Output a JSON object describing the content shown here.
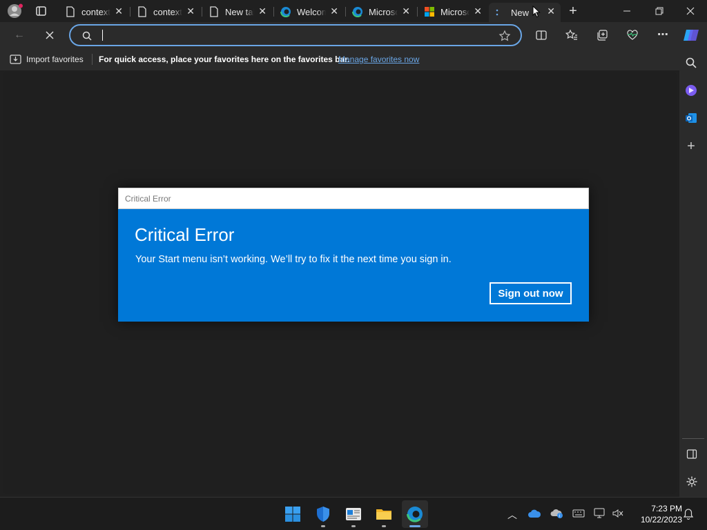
{
  "tabs": [
    {
      "title": "context",
      "favicon": "page-icon"
    },
    {
      "title": "context",
      "favicon": "page-icon"
    },
    {
      "title": "New tab",
      "favicon": "page-icon"
    },
    {
      "title": "Welcome",
      "favicon": "edge-icon"
    },
    {
      "title": "Microsoft",
      "favicon": "edge-icon"
    },
    {
      "title": "Microsoft",
      "favicon": "microsoft-logo-icon"
    },
    {
      "title": "New",
      "favicon": "loading-icon"
    }
  ],
  "address_bar": {
    "value": "",
    "placeholder": ""
  },
  "favorites_bar": {
    "import_label": "Import favorites",
    "hint": "For quick access, place your favorites here on the favorites bar.",
    "manage_link": "Manage favorites now"
  },
  "dialog": {
    "title_bar": "Critical Error",
    "heading": "Critical Error",
    "message": "Your Start menu isn’t working. We’ll try to fix it the next time you sign in.",
    "button": "Sign out now"
  },
  "clock": {
    "time": "7:23 PM",
    "date": "10/22/2023"
  },
  "colors": {
    "dialog_bg": "#0078d7",
    "link": "#6aa6e6",
    "address_focus": "#6aa6e6"
  }
}
